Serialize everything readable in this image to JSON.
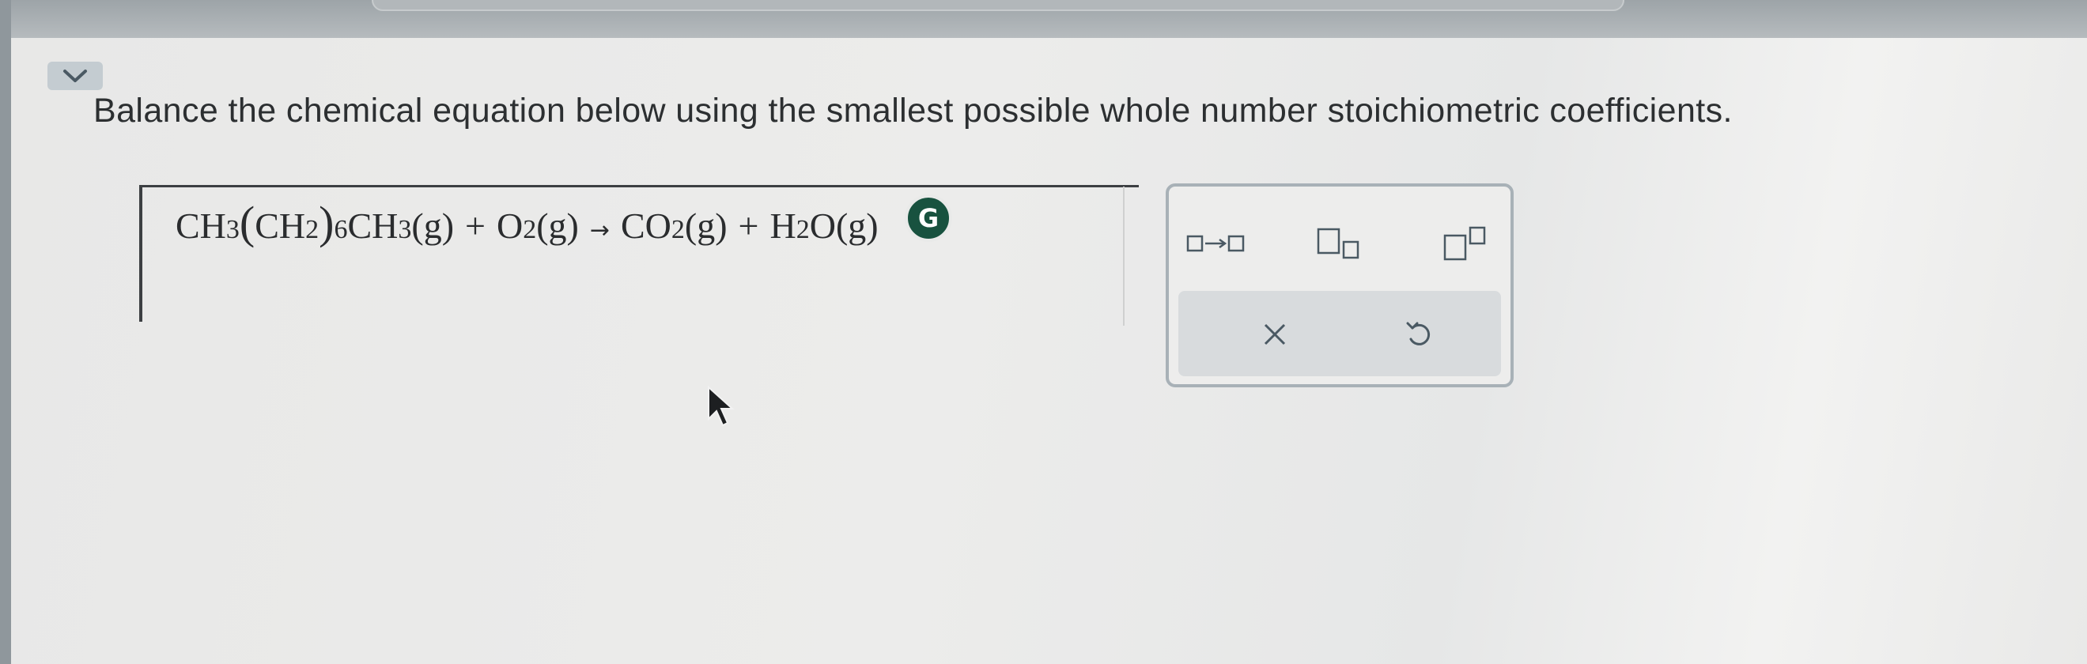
{
  "question": {
    "prompt": "Balance the chemical equation below using the smallest possible whole number stoichiometric coefficients."
  },
  "equation": {
    "reactant1": {
      "a": "CH",
      "a_sub": "3",
      "b": "CH",
      "b_sub": "2",
      "mult": "6",
      "c": "CH",
      "c_sub": "3",
      "state": "(g)"
    },
    "plus1": "+",
    "reactant2": {
      "a": "O",
      "a_sub": "2",
      "state": "(g)"
    },
    "arrow": "→",
    "product1": {
      "a": "CO",
      "a_sub": "2",
      "state": "(g)"
    },
    "plus2": "+",
    "product2": {
      "a": "H",
      "a_sub": "2",
      "b": "O",
      "state": "(g)"
    }
  },
  "toolbar": {
    "tools": [
      {
        "name": "reaction-arrow-tool",
        "icon": "box-arrow-box-icon"
      },
      {
        "name": "subscript-tool",
        "icon": "subscript-box-icon"
      },
      {
        "name": "superscript-tool",
        "icon": "superscript-box-icon"
      }
    ],
    "clear_icon": "close-icon",
    "undo_icon": "undo-icon"
  },
  "badges": {
    "grammarly_letter": "G"
  },
  "colors": {
    "accent": "#4a5963",
    "grammarly": "#18523f",
    "text": "#2c2f31"
  }
}
